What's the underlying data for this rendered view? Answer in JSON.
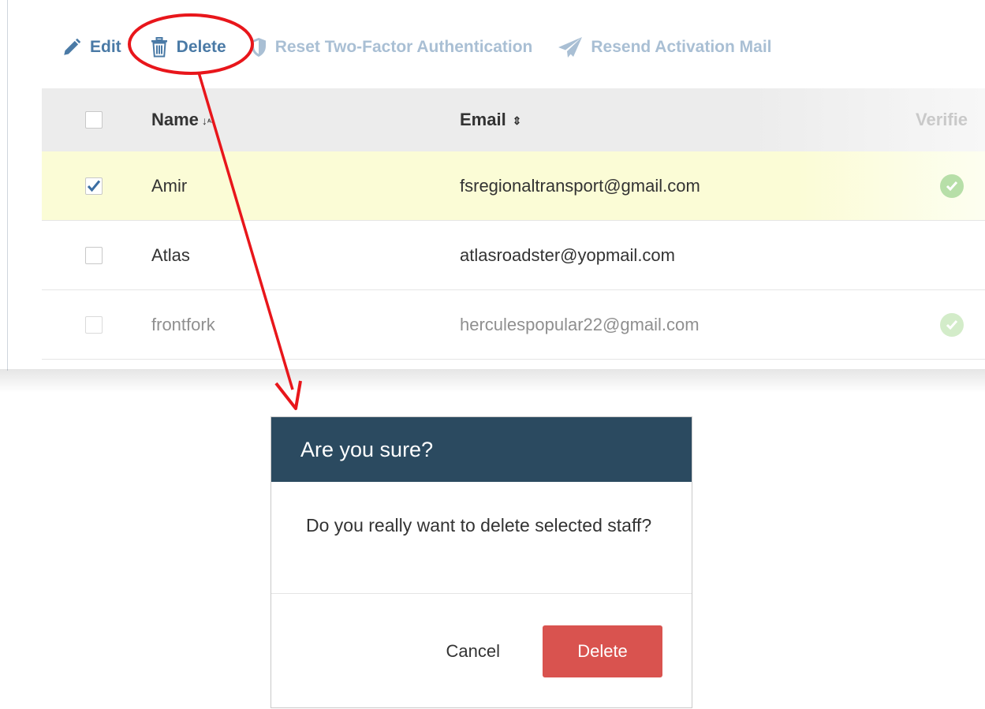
{
  "toolbar": {
    "edit_label": "Edit",
    "delete_label": "Delete",
    "reset_2fa_label": "Reset Two-Factor Authentication",
    "resend_label": "Resend Activation Mail"
  },
  "table": {
    "headers": {
      "name": "Name",
      "email": "Email",
      "verified": "Verifie"
    },
    "rows": [
      {
        "name": "Amir",
        "email": "fsregionaltransport@gmail.com",
        "checked": true,
        "verified": true
      },
      {
        "name": "Atlas",
        "email": "atlasroadster@yopmail.com",
        "checked": false,
        "verified": false
      },
      {
        "name": "frontfork",
        "email": "herculespopular22@gmail.com",
        "checked": false,
        "verified": true
      }
    ]
  },
  "dialog": {
    "title": "Are you sure?",
    "message": "Do you really want to delete selected staff?",
    "cancel_label": "Cancel",
    "confirm_label": "Delete"
  },
  "colors": {
    "dialog_header": "#2b4a60",
    "danger": "#d9534f",
    "annotation": "#e8161b",
    "link_active": "#4a7aa6",
    "link_disabled": "#a9bfd4",
    "selected_row": "#fbfcd6"
  }
}
